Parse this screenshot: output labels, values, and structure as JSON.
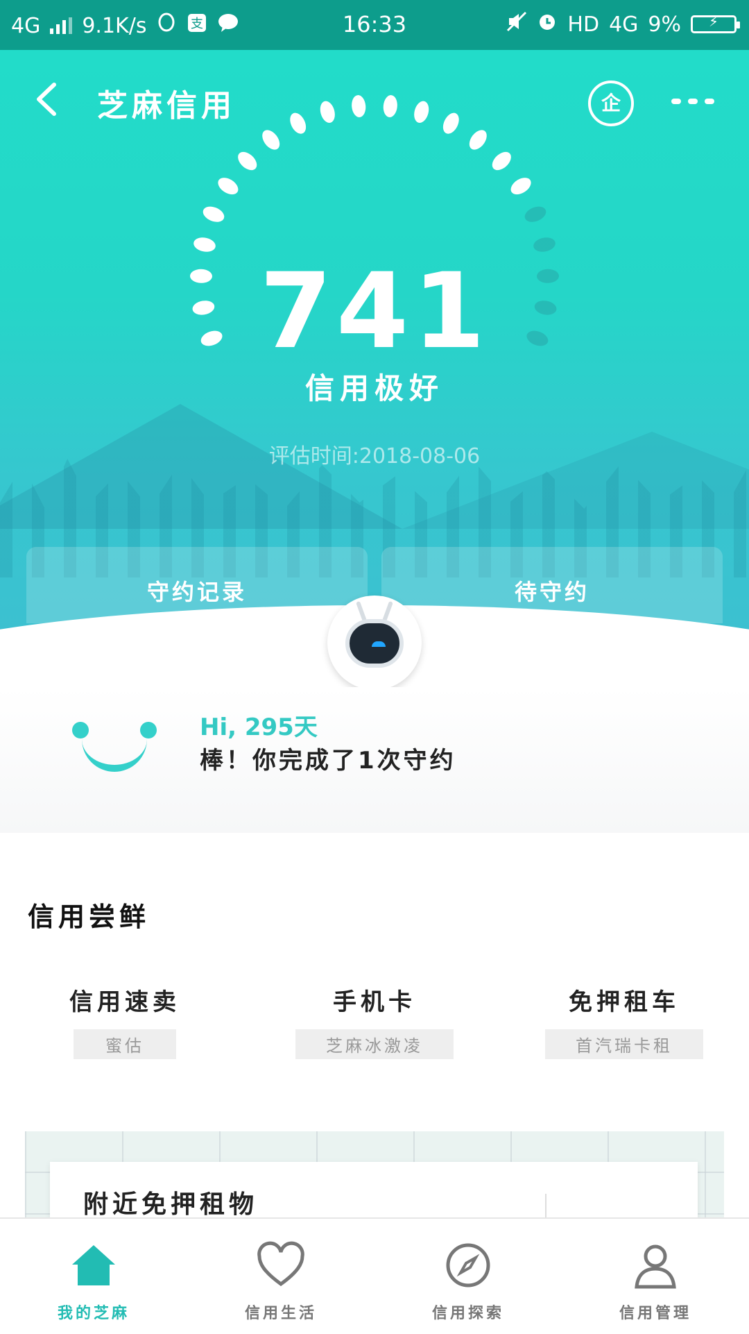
{
  "status_bar": {
    "network": "4G",
    "speed": "9.1K/s",
    "time": "16:33",
    "hd": "HD",
    "network_right": "4G",
    "battery": "9%",
    "icons": [
      "signal-icon",
      "qq-icon",
      "alipay-icon",
      "message-icon",
      "mute-icon",
      "alarm-icon",
      "battery-charging-icon"
    ]
  },
  "header": {
    "title": "芝麻信用",
    "enterprise_label": "企",
    "icons": [
      "back-arrow-icon",
      "enterprise-icon",
      "more-icon"
    ]
  },
  "score": {
    "value": "741",
    "level": "信用极好",
    "eval_time": "评估时间:2018-08-06"
  },
  "tabs": [
    {
      "label": "守约记录"
    },
    {
      "label": "待守约"
    }
  ],
  "greeting": {
    "hi": "Hi, 295天",
    "message": "棒！你完成了1次守约"
  },
  "section": {
    "title": "信用尝鲜",
    "products": [
      {
        "name": "信用速卖",
        "sub": "蜜估"
      },
      {
        "name": "手机卡",
        "sub": "芝麻冰激凌"
      },
      {
        "name": "免押租车",
        "sub": "首汽瑞卡租"
      }
    ]
  },
  "nearby": {
    "title": "附近免押租物"
  },
  "bottom_nav": [
    {
      "label": "我的芝麻",
      "icon": "home-icon",
      "active": true
    },
    {
      "label": "信用生活",
      "icon": "heart-icon",
      "active": false
    },
    {
      "label": "信用探索",
      "icon": "compass-icon",
      "active": false
    },
    {
      "label": "信用管理",
      "icon": "user-icon",
      "active": false
    }
  ],
  "colors": {
    "accent": "#22bcb3",
    "hero_top": "#22dcc9",
    "hero_bottom": "#3dbfd0",
    "status_bar": "#0d9d8c"
  }
}
